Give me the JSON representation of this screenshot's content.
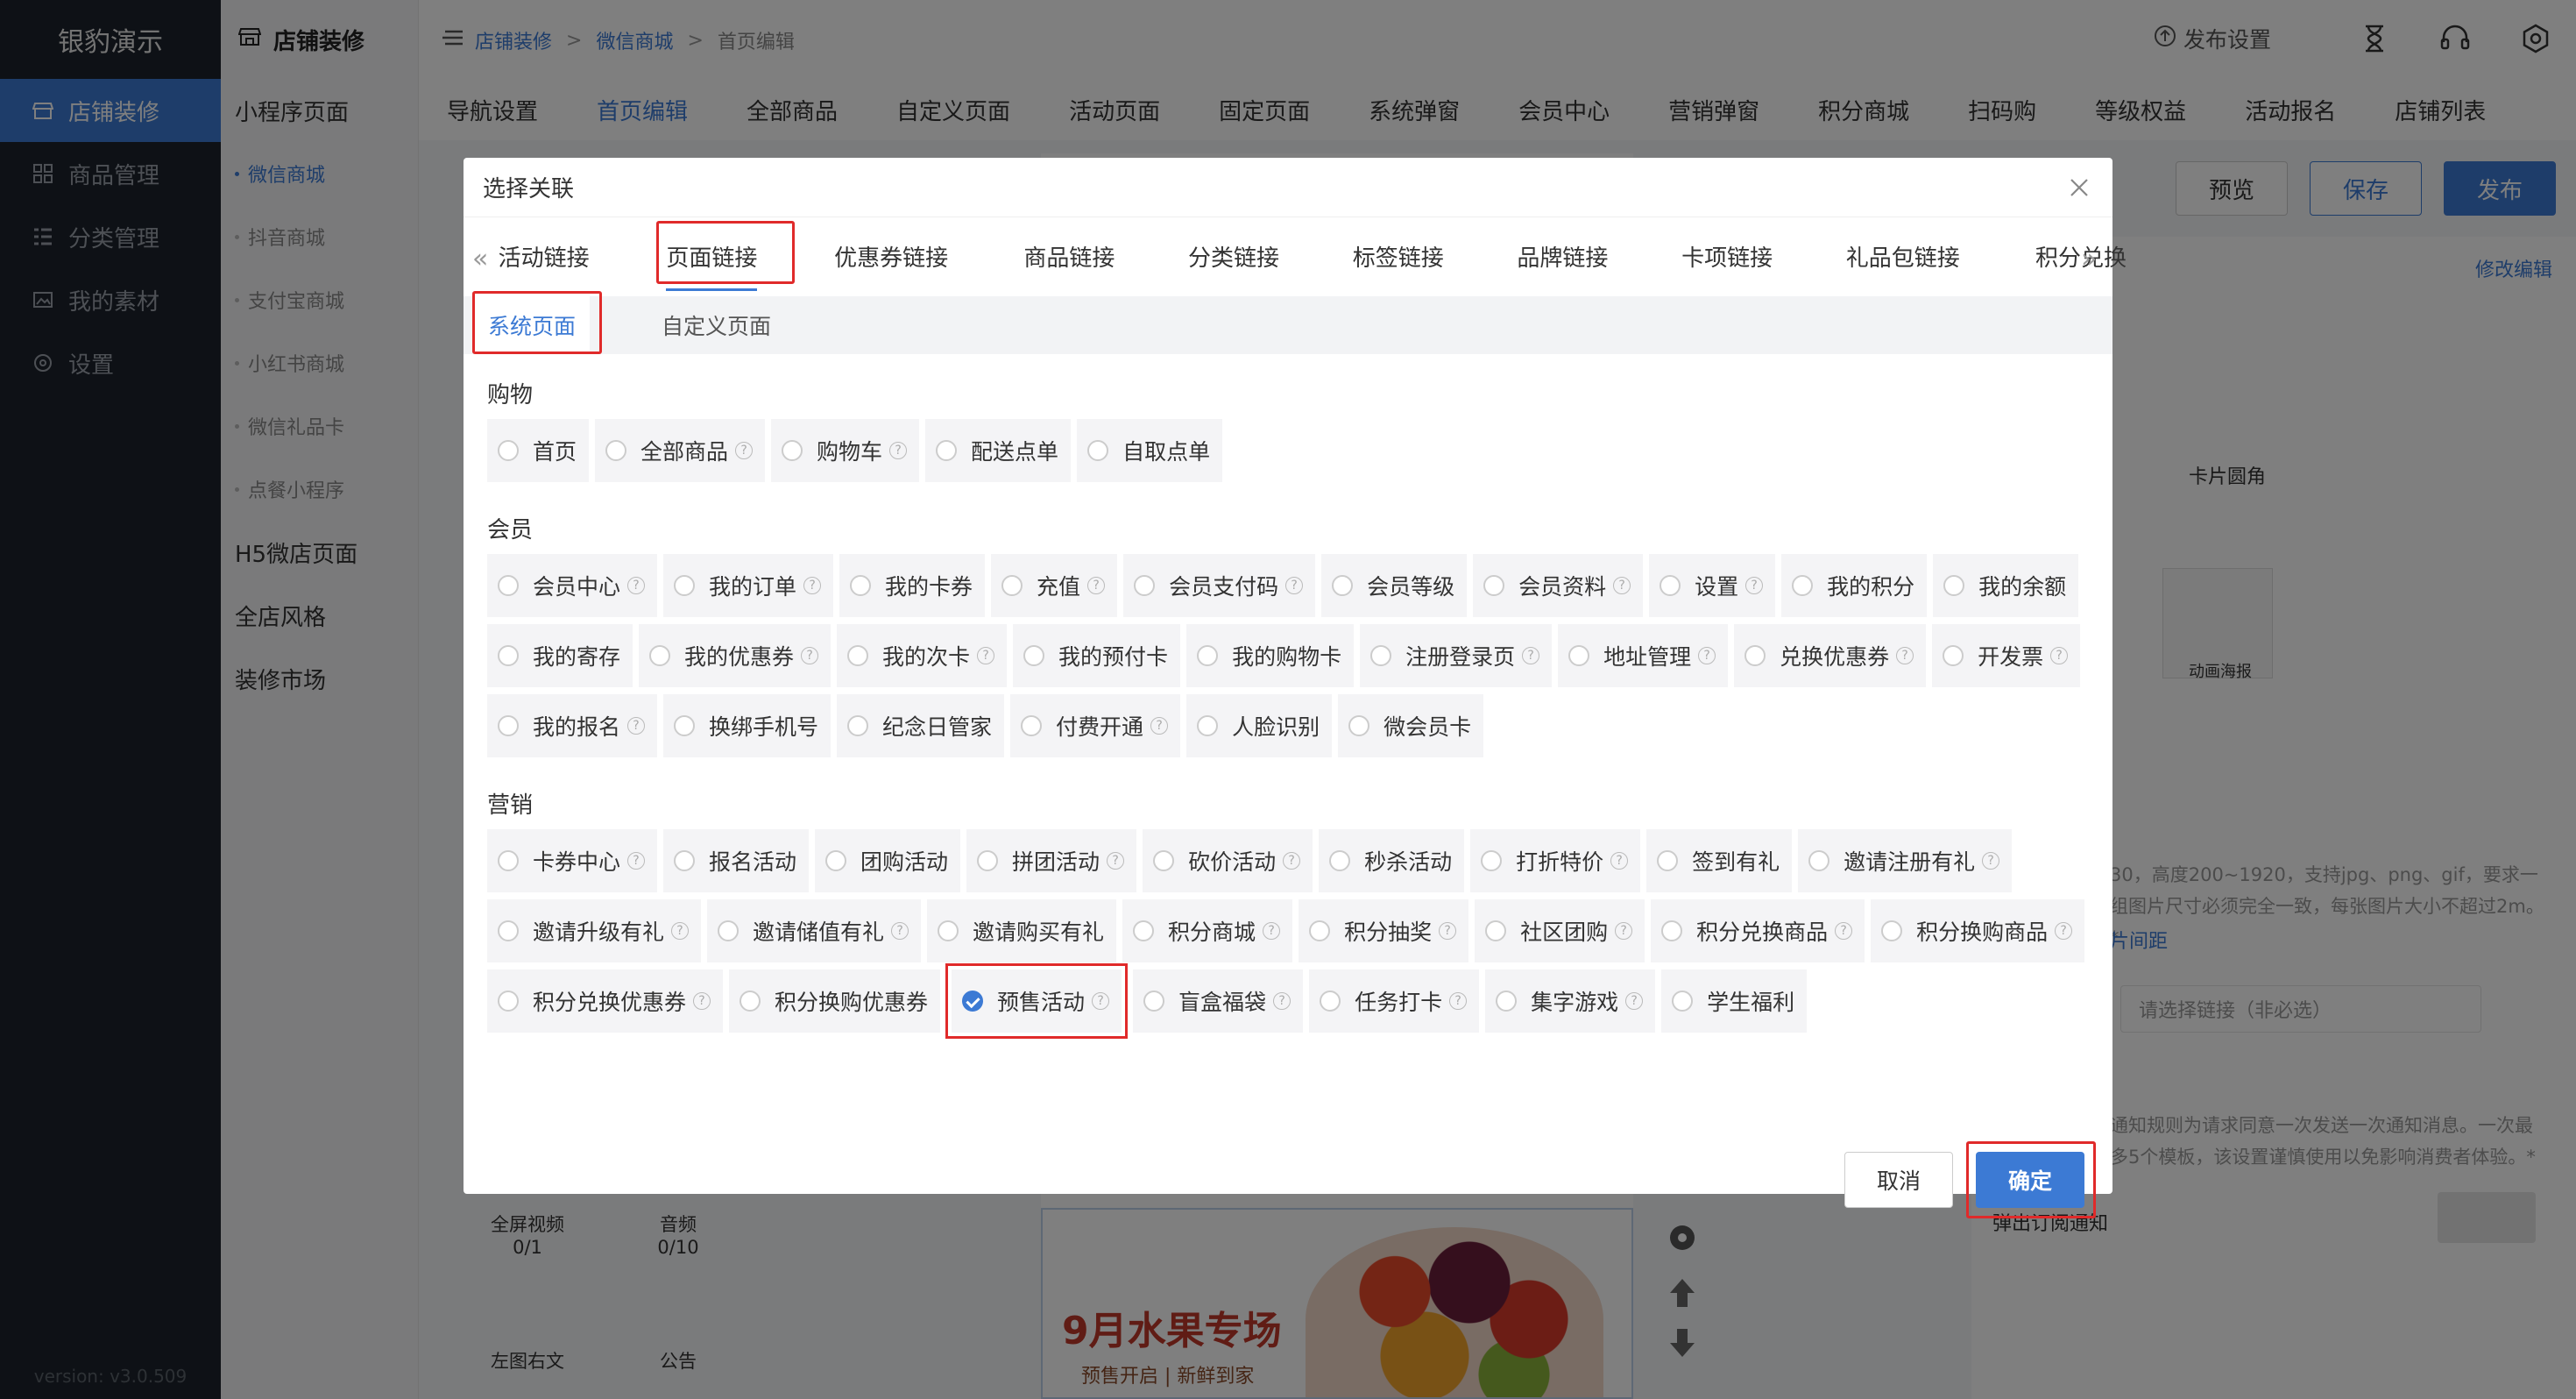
{
  "sidebar": {
    "brand": "银豹演示",
    "items": [
      {
        "label": "店铺装修",
        "icon": "store-icon",
        "active": true
      },
      {
        "label": "商品管理",
        "icon": "grid-icon"
      },
      {
        "label": "分类管理",
        "icon": "list-icon"
      },
      {
        "label": "我的素材",
        "icon": "image-icon"
      },
      {
        "label": "设置",
        "icon": "gear-icon"
      }
    ],
    "version": "version: v3.0.509"
  },
  "subnav": {
    "title": "店铺装修",
    "groups": [
      {
        "label": "小程序页面"
      },
      {
        "label": "微信商城",
        "sub": true,
        "active": true
      },
      {
        "label": "抖音商城",
        "sub": true
      },
      {
        "label": "支付宝商城",
        "sub": true
      },
      {
        "label": "小红书商城",
        "sub": true
      },
      {
        "label": "微信礼品卡",
        "sub": true
      },
      {
        "label": "点餐小程序",
        "sub": true
      },
      {
        "label": "H5微店页面"
      },
      {
        "label": "全店风格"
      },
      {
        "label": "装修市场"
      }
    ]
  },
  "header": {
    "breadcrumb": [
      "店铺装修",
      "微信商城",
      "首页编辑"
    ],
    "publish_settings": "发布设置",
    "tabs": [
      "导航设置",
      "首页编辑",
      "全部商品",
      "自定义页面",
      "活动页面",
      "固定页面",
      "系统弹窗",
      "会员中心",
      "营销弹窗",
      "积分商城",
      "扫码购",
      "等级权益",
      "活动报名",
      "店铺列表"
    ],
    "active_tab": 1
  },
  "actions": {
    "preview": "预览",
    "save": "保存",
    "publish": "发布"
  },
  "right_panel": {
    "modify": "修改编辑",
    "card_radius": "卡片圆角",
    "anim_poster": "动画海报",
    "hint1": "30，高度200~1920，支持jpg、png、gif，要求一组图片尺寸必须完全一致，每张图片大小不超过2m。*",
    "link_text": "片间距",
    "select_placeholder": "请选择链接（非必选）",
    "hint2": "通知规则为请求同意一次发送一次通知消息。一次最多5个模板，该设置谨慎使用以免影响消费者体验。*",
    "notice_label": "弹出订阅通知"
  },
  "left_widgets": {
    "video": "全屏视频",
    "video_count": "0/1",
    "audio": "音频",
    "audio_count": "0/10",
    "img_text": "左图右文",
    "notice": "公告"
  },
  "banner": {
    "title": "9月水果专场",
    "subtitle": "预售开启 | 新鲜到家"
  },
  "modal": {
    "title": "选择关联",
    "link_tabs": [
      "活动链接",
      "页面链接",
      "优惠券链接",
      "商品链接",
      "分类链接",
      "标签链接",
      "品牌链接",
      "卡项链接",
      "礼品包链接",
      "积分兑换"
    ],
    "active_link_tab": 1,
    "sub_tabs": [
      "系统页面",
      "自定义页面"
    ],
    "active_sub_tab": 0,
    "groups": [
      {
        "title": "购物",
        "options": [
          {
            "label": "首页",
            "help": false
          },
          {
            "label": "全部商品",
            "help": true
          },
          {
            "label": "购物车",
            "help": true
          },
          {
            "label": "配送点单",
            "help": false
          },
          {
            "label": "自取点单",
            "help": false
          }
        ]
      },
      {
        "title": "会员",
        "options": [
          {
            "label": "会员中心",
            "help": true
          },
          {
            "label": "我的订单",
            "help": true
          },
          {
            "label": "我的卡券",
            "help": false
          },
          {
            "label": "充值",
            "help": true
          },
          {
            "label": "会员支付码",
            "help": true
          },
          {
            "label": "会员等级",
            "help": false
          },
          {
            "label": "会员资料",
            "help": true
          },
          {
            "label": "设置",
            "help": true
          },
          {
            "label": "我的积分",
            "help": false
          },
          {
            "label": "我的余额",
            "help": false
          },
          {
            "label": "我的寄存",
            "help": false
          },
          {
            "label": "我的优惠券",
            "help": true
          },
          {
            "label": "我的次卡",
            "help": true
          },
          {
            "label": "我的预付卡",
            "help": false
          },
          {
            "label": "我的购物卡",
            "help": false
          },
          {
            "label": "注册登录页",
            "help": true
          },
          {
            "label": "地址管理",
            "help": true
          },
          {
            "label": "兑换优惠券",
            "help": true
          },
          {
            "label": "开发票",
            "help": true
          },
          {
            "label": "我的报名",
            "help": true
          },
          {
            "label": "换绑手机号",
            "help": false
          },
          {
            "label": "纪念日管家",
            "help": false
          },
          {
            "label": "付费开通",
            "help": true
          },
          {
            "label": "人脸识别",
            "help": false
          },
          {
            "label": "微会员卡",
            "help": false
          }
        ]
      },
      {
        "title": "营销",
        "options": [
          {
            "label": "卡券中心",
            "help": true
          },
          {
            "label": "报名活动",
            "help": false
          },
          {
            "label": "团购活动",
            "help": false
          },
          {
            "label": "拼团活动",
            "help": true
          },
          {
            "label": "砍价活动",
            "help": true
          },
          {
            "label": "秒杀活动",
            "help": false
          },
          {
            "label": "打折特价",
            "help": true
          },
          {
            "label": "签到有礼",
            "help": false
          },
          {
            "label": "邀请注册有礼",
            "help": true
          },
          {
            "label": "邀请升级有礼",
            "help": true
          },
          {
            "label": "邀请储值有礼",
            "help": true
          },
          {
            "label": "邀请购买有礼",
            "help": false
          },
          {
            "label": "积分商城",
            "help": true
          },
          {
            "label": "积分抽奖",
            "help": true
          },
          {
            "label": "社区团购",
            "help": true
          },
          {
            "label": "积分兑换商品",
            "help": true
          },
          {
            "label": "积分换购商品",
            "help": true
          },
          {
            "label": "积分兑换优惠券",
            "help": true
          },
          {
            "label": "积分换购优惠券",
            "help": false
          },
          {
            "label": "预售活动",
            "help": true,
            "checked": true
          },
          {
            "label": "盲盒福袋",
            "help": true
          },
          {
            "label": "任务打卡",
            "help": true
          },
          {
            "label": "集字游戏",
            "help": true
          },
          {
            "label": "学生福利",
            "help": false
          }
        ]
      }
    ],
    "cancel": "取消",
    "confirm": "确定"
  },
  "colors": {
    "accent": "#3c7ad4",
    "highlight": "#e02a2a",
    "sidebar": "#1d232c"
  }
}
